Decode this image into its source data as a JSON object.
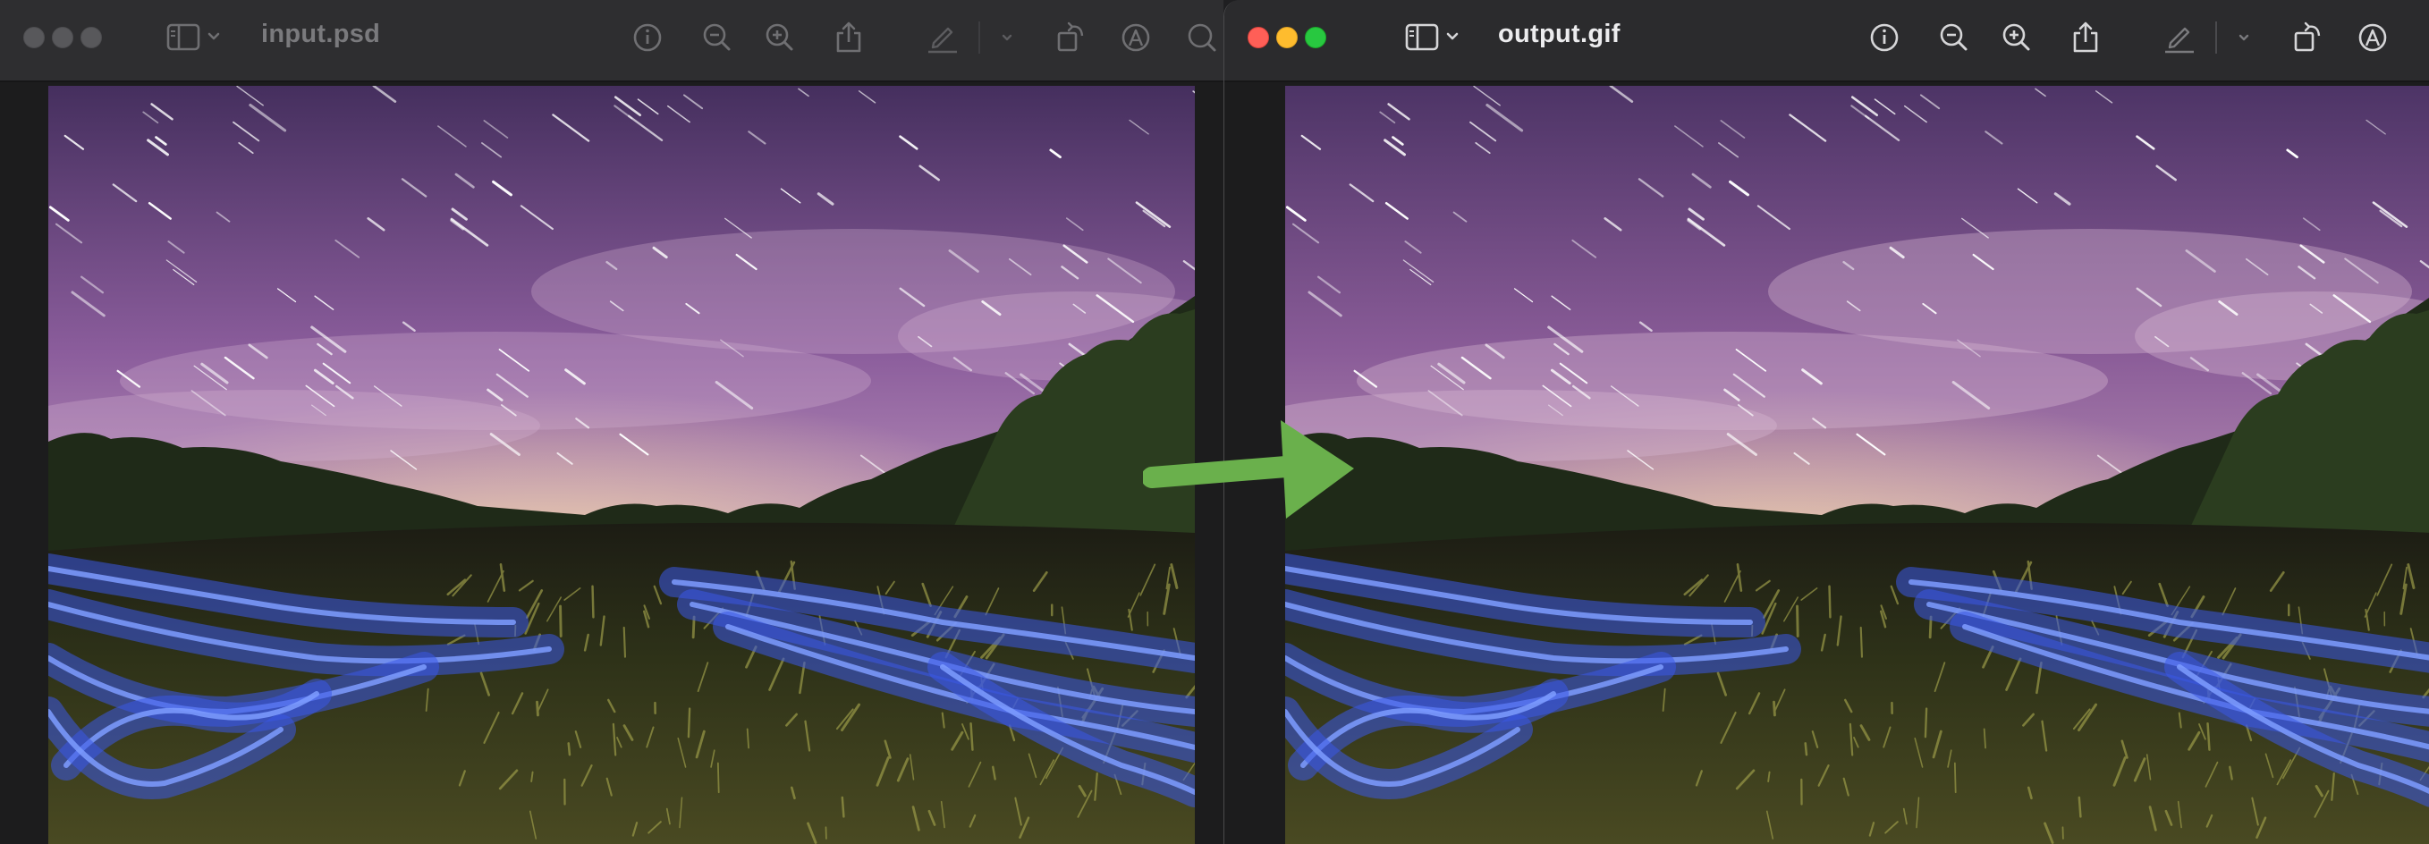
{
  "left_window": {
    "title": "input.psd",
    "state": "inactive",
    "traffic_lights": [
      "close",
      "minimize",
      "zoom"
    ],
    "toolbar_icons": [
      "sidebar-toggle-icon",
      "chevron-down-icon",
      "info-icon",
      "zoom-out-icon",
      "zoom-in-icon",
      "share-icon",
      "markup-pen-icon",
      "chevron-down-icon",
      "rotate-icon",
      "annotate-icon",
      "search-icon"
    ],
    "image": {
      "description_icon": "photo",
      "variant": "original"
    }
  },
  "right_window": {
    "title": "output.gif",
    "state": "active",
    "traffic_lights": [
      "close",
      "minimize",
      "zoom"
    ],
    "toolbar_icons": [
      "sidebar-toggle-icon",
      "chevron-down-icon",
      "info-icon",
      "zoom-out-icon",
      "zoom-in-icon",
      "share-icon",
      "markup-pen-icon",
      "chevron-down-icon",
      "rotate-icon",
      "annotate-icon"
    ],
    "image": {
      "variant": "converted"
    }
  },
  "overlay": {
    "arrow_icon": "right-arrow-icon",
    "arrow_color": "#6ab04c"
  },
  "colors": {
    "traffic_close": "#ff5f57",
    "traffic_minimize": "#febc2e",
    "traffic_zoom": "#28c840",
    "toolbar_bg": "#2b2b2d"
  }
}
